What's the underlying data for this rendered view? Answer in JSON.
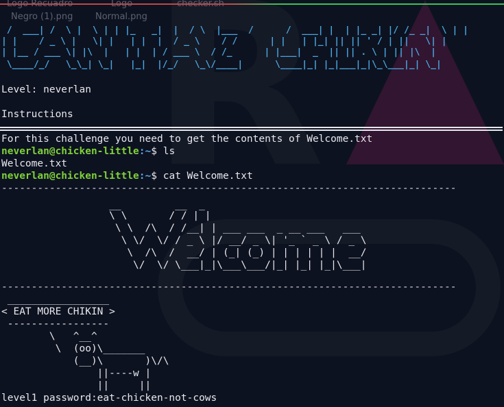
{
  "desktop": {
    "icons": [
      {
        "label": "Logo Recuadro"
      },
      {
        "label": "Logo"
      },
      {
        "label": "checker.sh"
      },
      {
        "label": "Negro (1).png"
      },
      {
        "label": "Normal.png"
      }
    ]
  },
  "terminal": {
    "banner_lines": [
      " /  ___| /  \\ |  \\ | | |_   _|  |  / \\  |___  /      /  ___| |  | |_ _| |/ /_ _|  \\ | |",
      "| |    / _ \\ |   \\| |   | |  |  / _ \\    / /      | |   | |_| || || ' / | ||   \\| |",
      "| |__ / ___ \\| |\\  |   | |  | / ___ \\  / /_      | |___|  _  || || . \\ | || |\\  |",
      " \\____/_/   \\_\\_| \\_|   |_|  |/_/   \\_\\/____|      \\____|_| |_|___|_|\\_\\___|_| \\_|"
    ],
    "level_line": "Level: neverlan",
    "instructions_heading": "Instructions",
    "challenge_text": "For this challenge you need to get the contents of Welcome.txt",
    "prompt_user": "neverlan@chicken-little",
    "prompt_path": ":~",
    "prompt_symbol": "$",
    "cmd1": " ls",
    "ls_output": "Welcome.txt",
    "cmd2": " cat Welcome.txt",
    "dash_line": "----------------------------------------------------------------------------",
    "welcome_art": [
      "                  __         __  _",
      "                  \\ \\       / / | |",
      "                   \\ \\  /\\  / /__| | ___ ___  _ __ ___   ___",
      "                    \\ \\/  \\/ / _ \\ |/ __/ _ \\| '_ ` _ \\ / _ \\",
      "                     \\  /\\  /  __/ | (_| (_) | | | | | |  __/",
      "                      \\/  \\/ \\___|_|\\___\\___/|_| |_| |_|\\___|"
    ],
    "cow_art": [
      " _________________",
      "< EAT MORE CHIKIN >",
      " -----------------",
      "        \\   ^__^",
      "         \\  (oo)\\_______",
      "            (__)\\       )\\/\\",
      "                ||----w |",
      "                ||     ||"
    ],
    "password_line": "level1 password:eat-chicken-not-cows"
  }
}
